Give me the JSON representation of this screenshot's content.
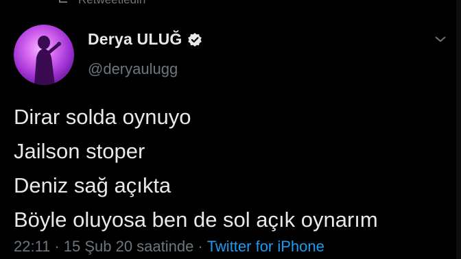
{
  "retweet": {
    "label": "Retweetledin",
    "icon": "retweet-icon"
  },
  "author": {
    "display_name": "Derya ULUĞ",
    "handle": "@deryaulugg",
    "verified": true,
    "verified_icon": "verified-badge-icon",
    "avatar_icon": "avatar"
  },
  "menu": {
    "icon": "chevron-down-icon"
  },
  "tweet": {
    "lines": [
      "Dirar solda oynuyo",
      "Jailson stoper",
      "Deniz sağ açıkta",
      "Böyle oluyosa ben de sol açık oynarım"
    ]
  },
  "meta": {
    "time": "22:11",
    "separator": "·",
    "date_text": "15 Şub 20 saatinde",
    "source": "Twitter for iPhone"
  },
  "colors": {
    "background": "#000000",
    "text": "#e7e9ea",
    "secondary": "#6e767d",
    "link": "#1d9bf0"
  }
}
